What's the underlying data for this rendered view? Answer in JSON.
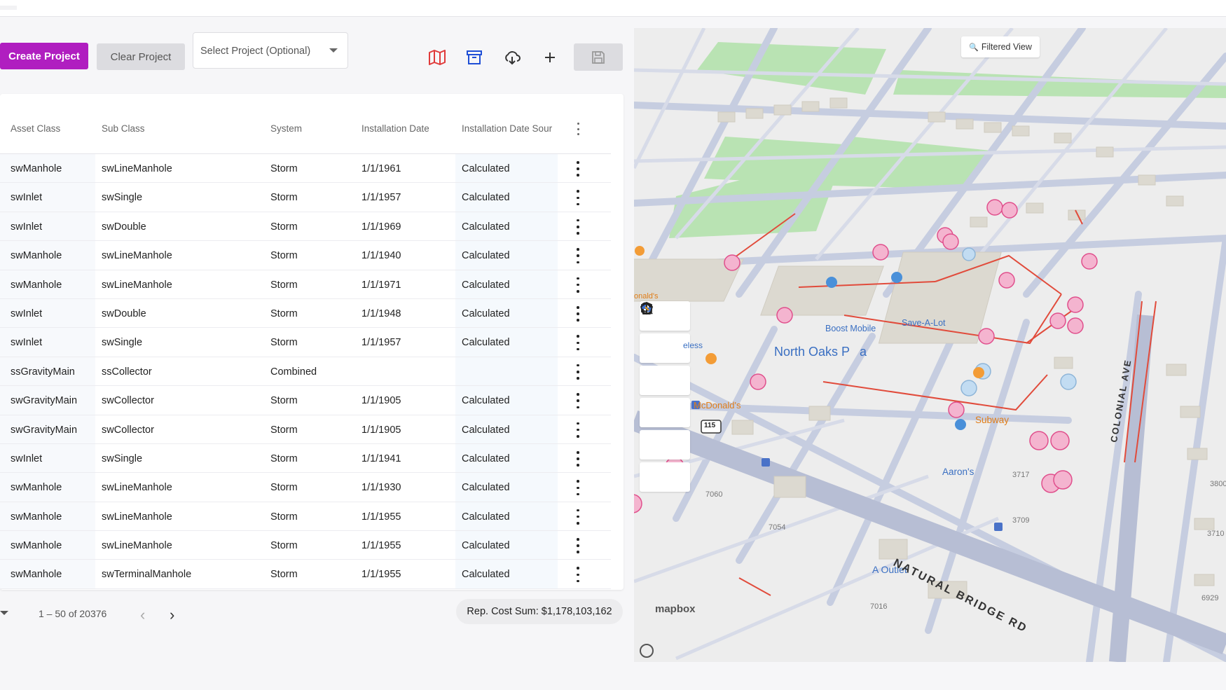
{
  "toolbar": {
    "create_label": "Create Project",
    "clear_label": "Clear Project",
    "select_placeholder": "Select Project (Optional)",
    "icons": [
      "map-icon",
      "archive-icon",
      "cloud-download-icon",
      "plus-icon",
      "save-icon"
    ],
    "accent": "#b01ec0",
    "icon_color": "#1f4fd6"
  },
  "table": {
    "columns": [
      "Asset Class",
      "Sub Class",
      "System",
      "Installation Date",
      "Installation Date Sour"
    ],
    "rows": [
      [
        "swManhole",
        "swLineManhole",
        "Storm",
        "1/1/1961",
        "Calculated"
      ],
      [
        "swInlet",
        "swSingle",
        "Storm",
        "1/1/1957",
        "Calculated"
      ],
      [
        "swInlet",
        "swDouble",
        "Storm",
        "1/1/1969",
        "Calculated"
      ],
      [
        "swManhole",
        "swLineManhole",
        "Storm",
        "1/1/1940",
        "Calculated"
      ],
      [
        "swManhole",
        "swLineManhole",
        "Storm",
        "1/1/1971",
        "Calculated"
      ],
      [
        "swInlet",
        "swDouble",
        "Storm",
        "1/1/1948",
        "Calculated"
      ],
      [
        "swInlet",
        "swSingle",
        "Storm",
        "1/1/1957",
        "Calculated"
      ],
      [
        "ssGravityMain",
        "ssCollector",
        "Combined",
        "",
        ""
      ],
      [
        "swGravityMain",
        "swCollector",
        "Storm",
        "1/1/1905",
        "Calculated"
      ],
      [
        "swGravityMain",
        "swCollector",
        "Storm",
        "1/1/1905",
        "Calculated"
      ],
      [
        "swInlet",
        "swSingle",
        "Storm",
        "1/1/1941",
        "Calculated"
      ],
      [
        "swManhole",
        "swLineManhole",
        "Storm",
        "1/1/1930",
        "Calculated"
      ],
      [
        "swManhole",
        "swLineManhole",
        "Storm",
        "1/1/1955",
        "Calculated"
      ],
      [
        "swManhole",
        "swLineManhole",
        "Storm",
        "1/1/1955",
        "Calculated"
      ],
      [
        "swManhole",
        "swTerminalManhole",
        "Storm",
        "1/1/1955",
        "Calculated"
      ]
    ]
  },
  "footer": {
    "range": "1 – 50 of 20376",
    "cost_sum": "Rep. Cost Sum: $1,178,103,162"
  },
  "map": {
    "filtered_view": "Filtered View",
    "controls": [
      "home-icon",
      "zoom-in-icon",
      "zoom-out-icon",
      "3d-view-icon",
      "satellite-icon",
      "polygon-icon"
    ],
    "labels": {
      "north_oaks": "North Oaks P",
      "north_oaks_suffix": "a",
      "boost_mobile": "Boost Mobile",
      "save_a_lot": "Save-A-Lot",
      "mcdonalds": "McDonald's",
      "subway": "Subway",
      "aarons": "Aaron's",
      "a_outlet": "A Outlet",
      "natural_bridge": "NATURAL BRIDGE RD",
      "colonial_ave": "COLONIAL AVE",
      "donalds_partial": "onald's",
      "less_partial": "eless",
      "route_115": "115",
      "n7060": "7060",
      "n7054": "7054",
      "n7016": "7016",
      "n3717": "3717",
      "n3709": "3709",
      "n3710": "3710",
      "n3800": "3800",
      "n6929": "6929",
      "mapbox": "mapbox"
    }
  }
}
